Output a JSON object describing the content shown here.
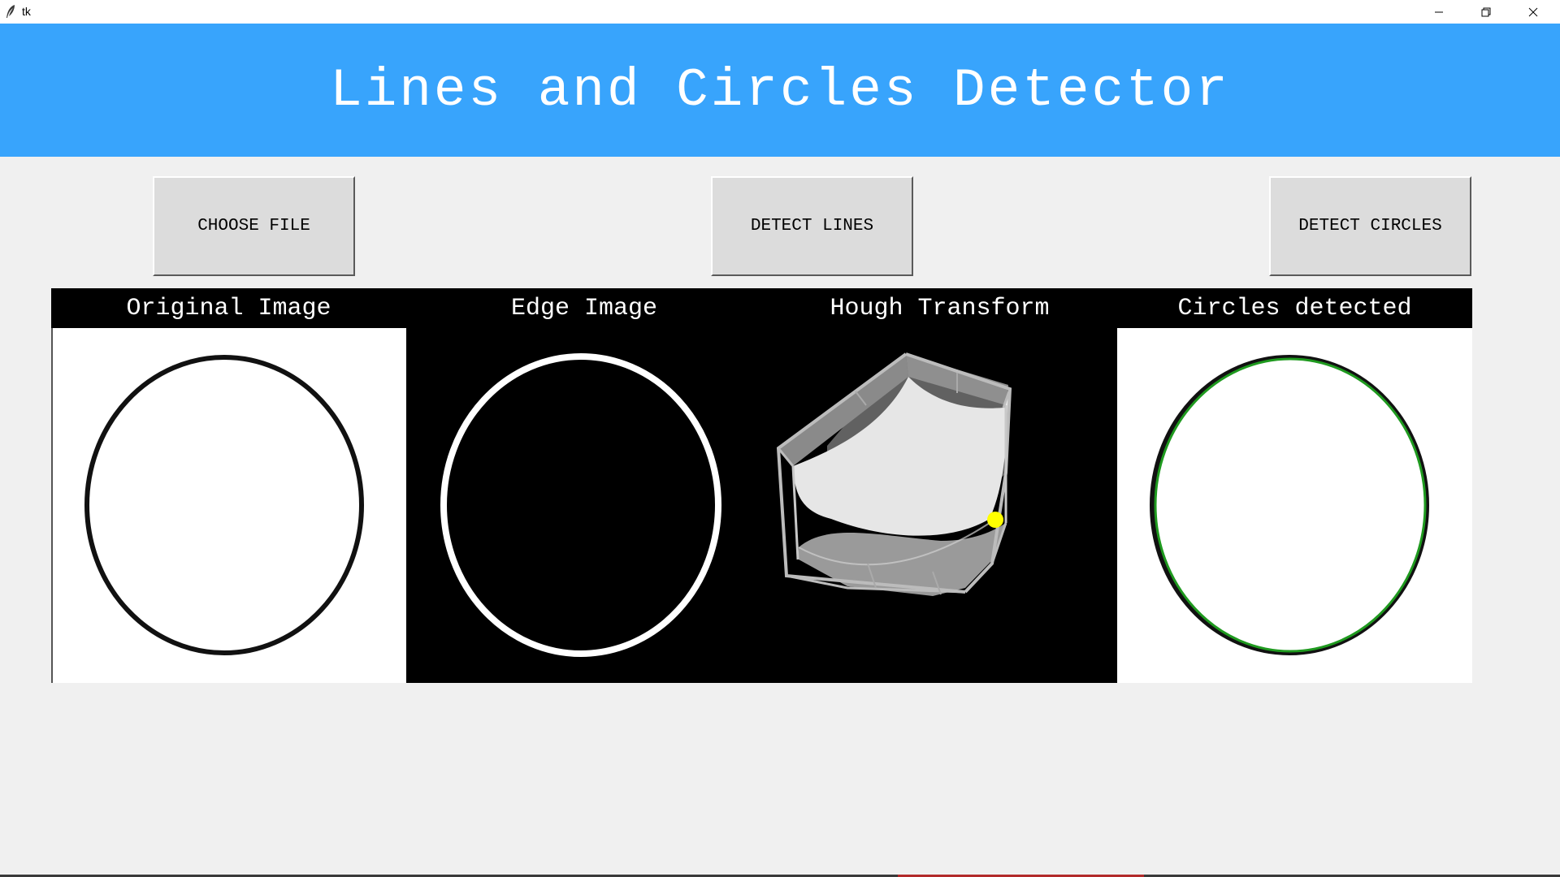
{
  "window": {
    "title": "tk",
    "controls": {
      "minimize_icon": "minimize-icon",
      "maximize_icon": "restore-icon",
      "close_icon": "close-icon"
    }
  },
  "header": {
    "title": "Lines and Circles Detector",
    "background_color": "#38a4fc",
    "text_color": "#ffffff"
  },
  "toolbar": {
    "choose_file_label": "CHOOSE FILE",
    "detect_lines_label": "DETECT LINES",
    "detect_circles_label": "DETECT CIRCLES"
  },
  "panels": [
    {
      "title": "Original Image",
      "image": "black-circle-on-white"
    },
    {
      "title": "Edge Image",
      "image": "white-circle-on-black"
    },
    {
      "title": "Hough Transform",
      "image": "3d-accumulator-with-yellow-peak"
    },
    {
      "title": "Circles detected",
      "image": "black-circle-with-green-overlay"
    }
  ],
  "colors": {
    "detected_circle": "#1f9a1f",
    "hough_peak": "#ffff00"
  }
}
